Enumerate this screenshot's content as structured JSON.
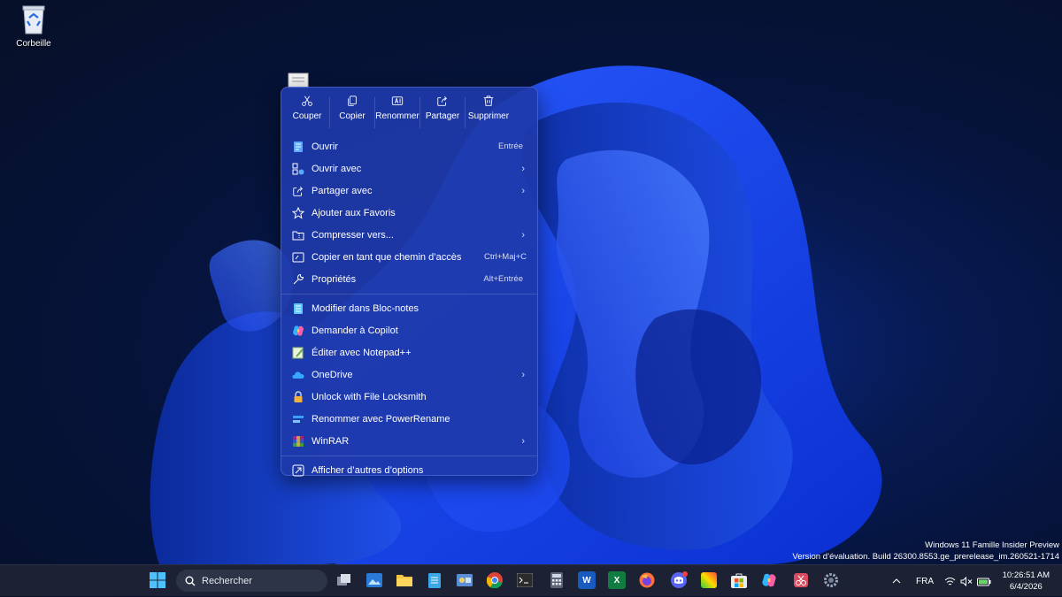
{
  "desktop": {
    "recycle_bin_label": "Corbeille"
  },
  "context_menu": {
    "quick_actions": [
      {
        "label": "Couper",
        "icon": "cut-icon"
      },
      {
        "label": "Copier",
        "icon": "copy-icon"
      },
      {
        "label": "Renommer",
        "icon": "rename-icon"
      },
      {
        "label": "Partager",
        "icon": "share-icon"
      },
      {
        "label": "Supprimer",
        "icon": "delete-icon"
      }
    ],
    "items": [
      {
        "label": "Ouvrir",
        "shortcut": "Entrée",
        "icon": "document-icon"
      },
      {
        "label": "Ouvrir avec",
        "submenu": "›",
        "icon": "open-with-icon"
      },
      {
        "label": "Partager avec",
        "submenu": "›",
        "icon": "share-icon"
      },
      {
        "label": "Ajouter aux Favoris",
        "icon": "star-icon"
      },
      {
        "label": "Compresser vers...",
        "submenu": "›",
        "icon": "folder-zip-icon"
      },
      {
        "label": "Copier en tant que chemin d’accès",
        "shortcut": "Ctrl+Maj+C",
        "icon": "copy-path-icon"
      },
      {
        "label": "Propriétés",
        "shortcut": "Alt+Entrée",
        "icon": "wrench-icon"
      },
      {
        "label": "Modifier dans Bloc-notes",
        "icon": "notepad-icon"
      },
      {
        "label": "Demander à Copilot",
        "icon": "copilot-icon"
      },
      {
        "label": "Éditer avec Notepad++",
        "icon": "notepadpp-icon"
      },
      {
        "label": "OneDrive",
        "submenu": "›",
        "icon": "onedrive-icon"
      },
      {
        "label": "Unlock with File Locksmith",
        "icon": "lock-icon"
      },
      {
        "label": "Renommer avec PowerRename",
        "icon": "powerrename-icon"
      },
      {
        "label": "WinRAR",
        "submenu": "›",
        "icon": "winrar-icon"
      },
      {
        "label": "Afficher d’autres d’options",
        "icon": "more-options-icon"
      }
    ]
  },
  "watermark": {
    "line1": "Windows 11 Famille Insider Preview",
    "line2": "Version d’évaluation. Build 26300.8553.ge_prerelease_im.260521-1714"
  },
  "taskbar": {
    "search_placeholder": "Rechercher",
    "language": "FRA",
    "time": "10:26:51 AM",
    "date": "6/4/2026",
    "colors": {
      "bar": "#1c2233",
      "accent": "#3b6cff"
    }
  }
}
